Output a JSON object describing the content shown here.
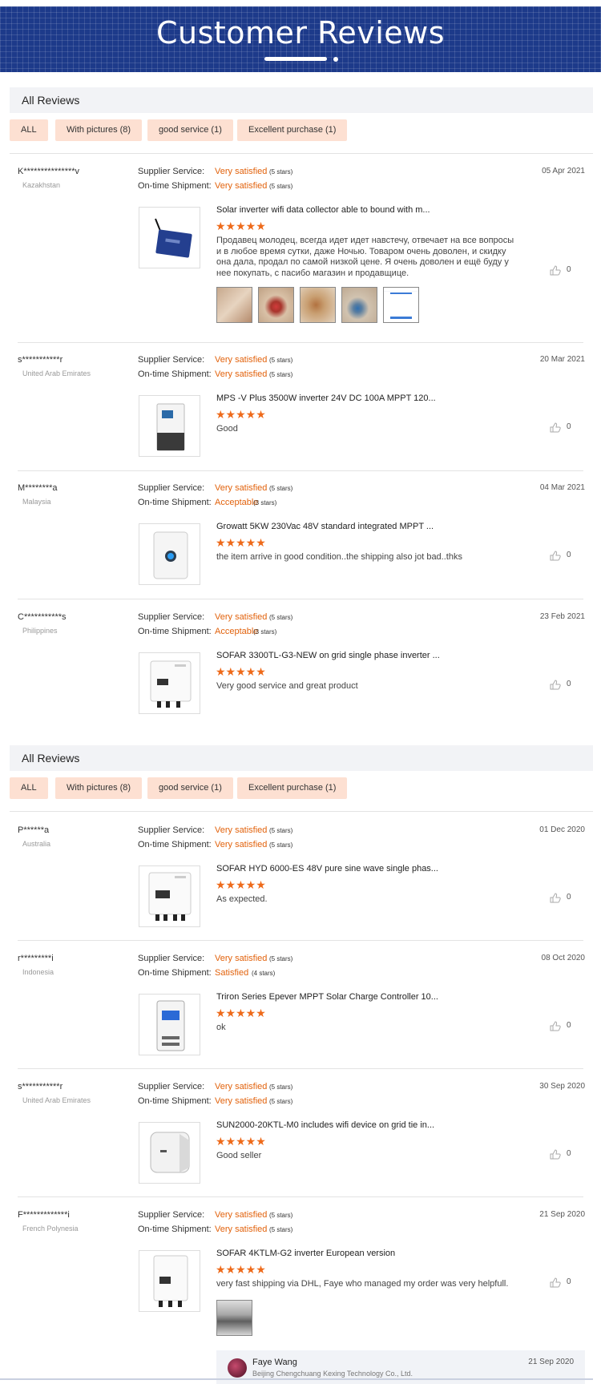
{
  "header": {
    "title": "Customer Reviews"
  },
  "sections": [
    {
      "heading": "All Reviews",
      "filters": [
        "ALL",
        "With pictures (8)",
        "good service (1)",
        "Excellent purchase (1)"
      ],
      "reviews": [
        {
          "user": "K***************v",
          "country": "Kazakhstan",
          "date": "05 Apr 2021",
          "supplier_label": "Supplier Service:",
          "supplier_value": "Very satisfied",
          "supplier_stars": "(5 stars)",
          "shipment_label": "On-time Shipment:",
          "shipment_value": "Very satisfied",
          "shipment_stars": "(5 stars)",
          "product": "Solar inverter wifi data collector able to bound with m...",
          "rating": "★★★★★",
          "text": "Продавец молодец, всегда идет идет навстечу, отвечает на все вопросы и в любое время сутки, даже Ночью. Товаром очень доволен, и скидку она дала, продал по самой низкой цене. Я очень доволен и ещё буду у нее покупать, с пасибо магазин и продавщице.",
          "likes": "0"
        },
        {
          "user": "s***********r",
          "country": "United Arab Emirates",
          "date": "20 Mar 2021",
          "supplier_label": "Supplier Service:",
          "supplier_value": "Very satisfied",
          "supplier_stars": "(5 stars)",
          "shipment_label": "On-time Shipment:",
          "shipment_value": "Very satisfied",
          "shipment_stars": "(5 stars)",
          "product": "MPS -V Plus 3500W inverter 24V DC 100A MPPT 120...",
          "rating": "★★★★★",
          "text": "Good",
          "likes": "0"
        },
        {
          "user": "M********a",
          "country": "Malaysia",
          "date": "04 Mar 2021",
          "supplier_label": "Supplier Service:",
          "supplier_value": "Very satisfied",
          "supplier_stars": "(5 stars)",
          "shipment_label": "On-time Shipment:",
          "shipment_value": "Acceptable",
          "shipment_stars": "(3 stars)",
          "product": "Growatt 5KW 230Vac 48V standard integrated MPPT ...",
          "rating": "★★★★★",
          "text": "the item arrive in good condition..the shipping also jot bad..thks",
          "likes": "0"
        },
        {
          "user": "C***********s",
          "country": "Philippines",
          "date": "23 Feb 2021",
          "supplier_label": "Supplier Service:",
          "supplier_value": "Very satisfied",
          "supplier_stars": "(5 stars)",
          "shipment_label": "On-time Shipment:",
          "shipment_value": "Acceptable",
          "shipment_stars": "(3 stars)",
          "product": "SOFAR 3300TL-G3-NEW on grid single phase inverter ...",
          "rating": "★★★★★",
          "text": "Very good service and great product",
          "likes": "0"
        }
      ]
    },
    {
      "heading": "All Reviews",
      "filters": [
        "ALL",
        "With pictures (8)",
        "good service (1)",
        "Excellent purchase (1)"
      ],
      "reviews": [
        {
          "user": "P******a",
          "country": "Australia",
          "date": "01 Dec 2020",
          "supplier_label": "Supplier Service:",
          "supplier_value": "Very satisfied",
          "supplier_stars": "(5 stars)",
          "shipment_label": "On-time Shipment:",
          "shipment_value": "Very satisfied",
          "shipment_stars": "(5 stars)",
          "product": "SOFAR HYD 6000-ES 48V pure sine wave single phas...",
          "rating": "★★★★★",
          "text": "As expected.",
          "likes": "0"
        },
        {
          "user": "r*********i",
          "country": "Indonesia",
          "date": "08 Oct 2020",
          "supplier_label": "Supplier Service:",
          "supplier_value": "Very satisfied",
          "supplier_stars": "(5 stars)",
          "shipment_label": "On-time Shipment:",
          "shipment_value": "Satisfied",
          "shipment_stars": "(4 stars)",
          "product": "Triron Series Epever MPPT Solar Charge Controller 10...",
          "rating": "★★★★★",
          "text": "ok",
          "likes": "0"
        },
        {
          "user": "s***********r",
          "country": "United Arab Emirates",
          "date": "30 Sep 2020",
          "supplier_label": "Supplier Service:",
          "supplier_value": "Very satisfied",
          "supplier_stars": "(5 stars)",
          "shipment_label": "On-time Shipment:",
          "shipment_value": "Very satisfied",
          "shipment_stars": "(5 stars)",
          "product": "SUN2000-20KTL-M0 includes wifi device on grid tie in...",
          "rating": "★★★★★",
          "text": "Good seller",
          "likes": "0"
        },
        {
          "user": "F*************i",
          "country": "French Polynesia",
          "date": "21 Sep 2020",
          "supplier_label": "Supplier Service:",
          "supplier_value": "Very satisfied",
          "supplier_stars": "(5 stars)",
          "shipment_label": "On-time Shipment:",
          "shipment_value": "Very satisfied",
          "shipment_stars": "(5 stars)",
          "product": "SOFAR 4KTLM-G2 inverter European version",
          "rating": "★★★★★",
          "text": "very fast shipping via DHL, Faye who managed my order was very helpfull.",
          "likes": "0"
        }
      ]
    }
  ],
  "reply": {
    "name": "Faye Wang",
    "company": "Beijing Chengchuang Kexing Technology Co., Ltd.",
    "date": "21 Sep 2020"
  },
  "icons": {
    "like": "thumbs-up-icon"
  },
  "colors": {
    "banner": "#1d3a8a",
    "accent": "#e2620c",
    "chip": "#fde0d2"
  }
}
